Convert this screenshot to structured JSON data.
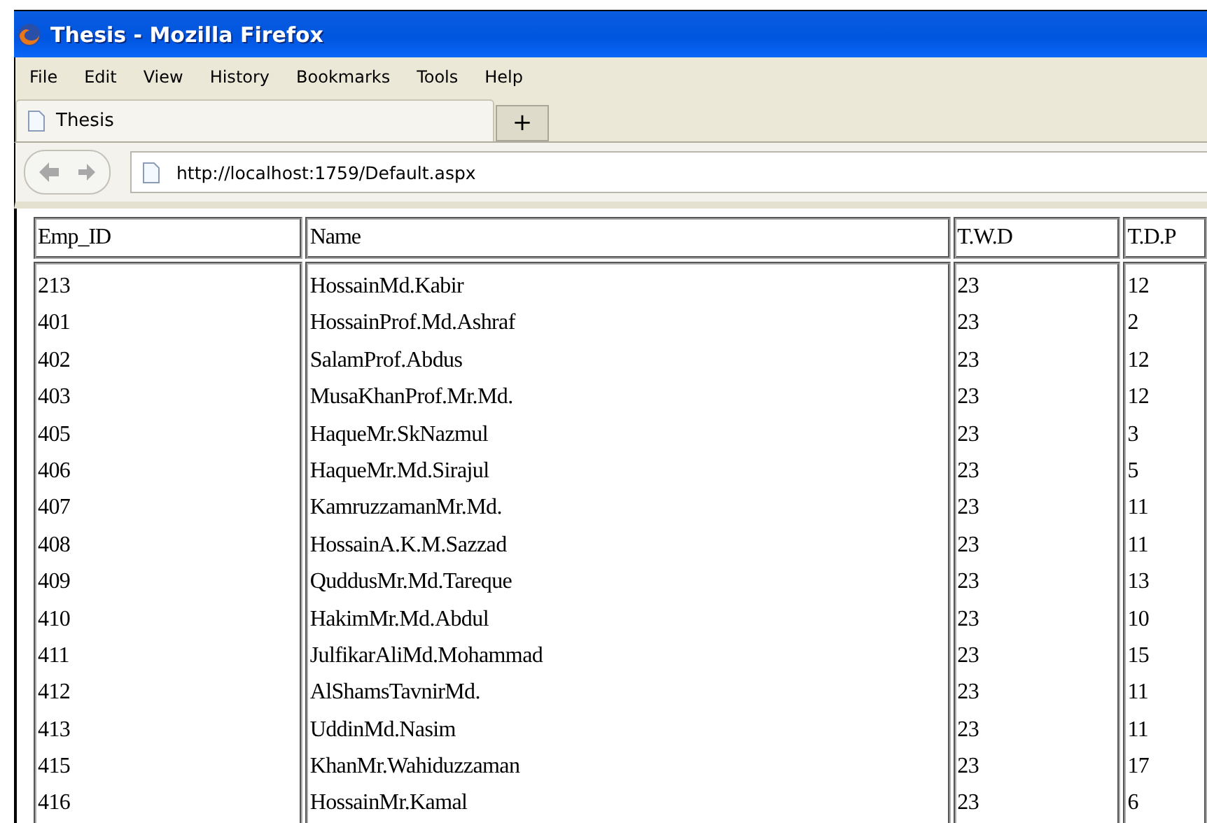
{
  "window": {
    "title": "Thesis - Mozilla Firefox"
  },
  "menu": [
    "File",
    "Edit",
    "View",
    "History",
    "Bookmarks",
    "Tools",
    "Help"
  ],
  "tabs": [
    {
      "label": "Thesis",
      "selected": true
    },
    {
      "label": "+",
      "selected": false
    }
  ],
  "address": {
    "value": "http://localhost:1759/Default.aspx"
  },
  "table": {
    "columns": [
      "Emp_ID",
      "Name",
      "T.W.D",
      "T.D.P"
    ],
    "rows": [
      [
        "213",
        "HossainMd.Kabir",
        "23",
        "12"
      ],
      [
        "401",
        "HossainProf.Md.Ashraf",
        "23",
        "2"
      ],
      [
        "402",
        "SalamProf.Abdus",
        "23",
        "12"
      ],
      [
        "403",
        "MusaKhanProf.Mr.Md.",
        "23",
        "12"
      ],
      [
        "405",
        "HaqueMr.SkNazmul",
        "23",
        "3"
      ],
      [
        "406",
        "HaqueMr.Md.Sirajul",
        "23",
        "5"
      ],
      [
        "407",
        "KamruzzamanMr.Md.",
        "23",
        "11"
      ],
      [
        "408",
        "HossainA.K.M.Sazzad",
        "23",
        "11"
      ],
      [
        "409",
        "QuddusMr.Md.Tareque",
        "23",
        "13"
      ],
      [
        "410",
        "HakimMr.Md.Abdul",
        "23",
        "10"
      ],
      [
        "411",
        "JulfikarAliMd.Mohammad",
        "23",
        "15"
      ],
      [
        "412",
        "AlShamsTavnirMd.",
        "23",
        "11"
      ],
      [
        "413",
        "UddinMd.Nasim",
        "23",
        "11"
      ],
      [
        "415",
        "KhanMr.Wahiduzzaman",
        "23",
        "17"
      ],
      [
        "416",
        "HossainMr.Kamal",
        "23",
        "6"
      ]
    ]
  }
}
